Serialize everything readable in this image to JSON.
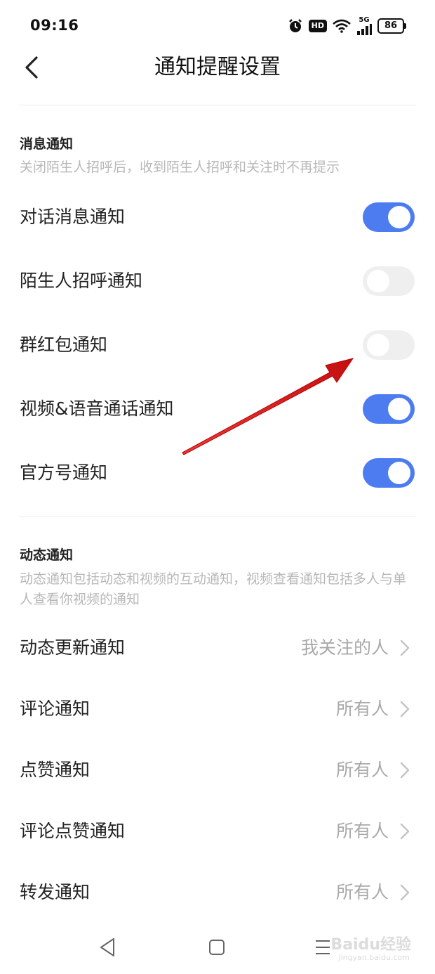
{
  "status_bar": {
    "time": "09:16",
    "hd": "HD",
    "network": "5G",
    "battery": "86"
  },
  "header": {
    "title": "通知提醒设置"
  },
  "message_section": {
    "title": "消息通知",
    "description": "关闭陌生人招呼后，收到陌生人招呼和关注时不再提示",
    "items": [
      {
        "label": "对话消息通知",
        "on": true
      },
      {
        "label": "陌生人招呼通知",
        "on": false
      },
      {
        "label": "群红包通知",
        "on": false
      },
      {
        "label": "视频&语音通话通知",
        "on": true
      },
      {
        "label": "官方号通知",
        "on": true
      }
    ]
  },
  "dynamic_section": {
    "title": "动态通知",
    "description": "动态通知包括动态和视频的互动通知，视频查看通知包括多人与单人查看你视频的通知",
    "items": [
      {
        "label": "动态更新通知",
        "value": "我关注的人"
      },
      {
        "label": "评论通知",
        "value": "所有人"
      },
      {
        "label": "点赞通知",
        "value": "所有人"
      },
      {
        "label": "评论点赞通知",
        "value": "所有人"
      },
      {
        "label": "转发通知",
        "value": "所有人"
      }
    ]
  },
  "watermark": {
    "text": "Baidu经验",
    "sub": "jingyan.baidu.com"
  },
  "colors": {
    "toggle_on": "#4c7cf0",
    "toggle_off": "#efefef",
    "annotation_arrow": "#e01b1b"
  }
}
